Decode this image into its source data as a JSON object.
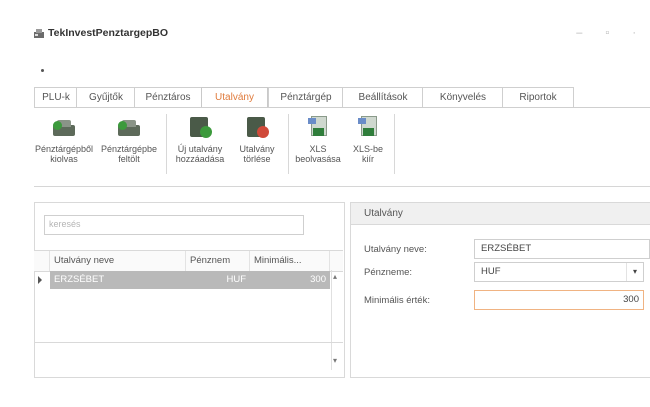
{
  "window": {
    "title": "TekInvestPenztargepBO",
    "controls": "– ▫ ·"
  },
  "tabs": [
    {
      "label": "PLU-k",
      "active": false
    },
    {
      "label": "Gyűjtők",
      "active": false
    },
    {
      "label": "Pénztáros",
      "active": false
    },
    {
      "label": "Utalvány",
      "active": true
    },
    {
      "label": "Pénztárgép",
      "active": false
    },
    {
      "label": "Beállítások",
      "active": false
    },
    {
      "label": "Könyvelés",
      "active": false
    },
    {
      "label": "Riportok",
      "active": false
    }
  ],
  "ribbon": {
    "buttons": [
      {
        "label1": "Pénztárgépből",
        "label2": "kiolvas",
        "icon": "cash-register-read-icon"
      },
      {
        "label1": "Pénztárgépbe",
        "label2": "feltölt",
        "icon": "cash-register-upload-icon"
      },
      {
        "label1": "Új utalvány",
        "label2": "hozzáadása",
        "icon": "voucher-add-icon"
      },
      {
        "label1": "Utalvány",
        "label2": "törlése",
        "icon": "voucher-delete-icon"
      },
      {
        "label1": "XLS",
        "label2": "beolvasása",
        "icon": "xls-import-icon"
      },
      {
        "label1": "XLS-be",
        "label2": "kiír",
        "icon": "xls-export-icon"
      }
    ]
  },
  "search": {
    "placeholder": "keresés"
  },
  "grid": {
    "columns": [
      "Utalvány neve",
      "Pénznem",
      "Minimális..."
    ],
    "rows": [
      {
        "name": "ERZSÉBET",
        "currency": "HUF",
        "minimum": "300"
      }
    ]
  },
  "detail": {
    "title": "Utalvány",
    "name_label": "Utalvány neve:",
    "name_value": "ERZSÉBET",
    "currency_label": "Pénzneme:",
    "currency_value": "HUF",
    "min_label": "Minimális érték:",
    "min_value": "300"
  },
  "colors": {
    "active_tab": "#e07b3c",
    "selected_row": "#b9b9b9",
    "focus_border": "#f0b382"
  }
}
